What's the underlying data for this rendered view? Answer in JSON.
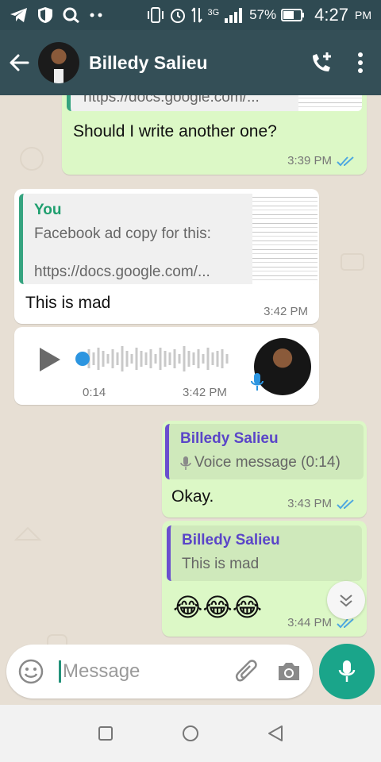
{
  "status_bar": {
    "network": "3G",
    "battery": "57%",
    "time": "4:27",
    "ampm": "PM"
  },
  "header": {
    "contact_name": "Billedy Salieu"
  },
  "messages": [
    {
      "quote_text": "https://docs.google.com/...",
      "text": "Should I write another one?",
      "time": "3:39 PM"
    },
    {
      "quote_author": "You",
      "quote_line1": "Facebook ad copy for this:",
      "quote_line2": "https://docs.google.com/...",
      "text": "This is mad",
      "time": "3:42 PM"
    },
    {
      "duration": "0:14",
      "time": "3:42 PM",
      "progress": 0
    },
    {
      "quote_author": "Billedy Salieu",
      "quote_text": "Voice message (0:14)",
      "text": "Okay.",
      "time": "3:43 PM"
    },
    {
      "quote_author": "Billedy Salieu",
      "quote_text": "This is mad",
      "text": "😂😂😂",
      "time": "3:44 PM"
    }
  ],
  "input": {
    "placeholder": "Message"
  },
  "colors": {
    "header": "#344f57",
    "outgoing_bubble": "#dcf8c6",
    "incoming_bubble": "#ffffff",
    "accent": "#1aa58a",
    "read_ticks": "#4fa8e0"
  }
}
